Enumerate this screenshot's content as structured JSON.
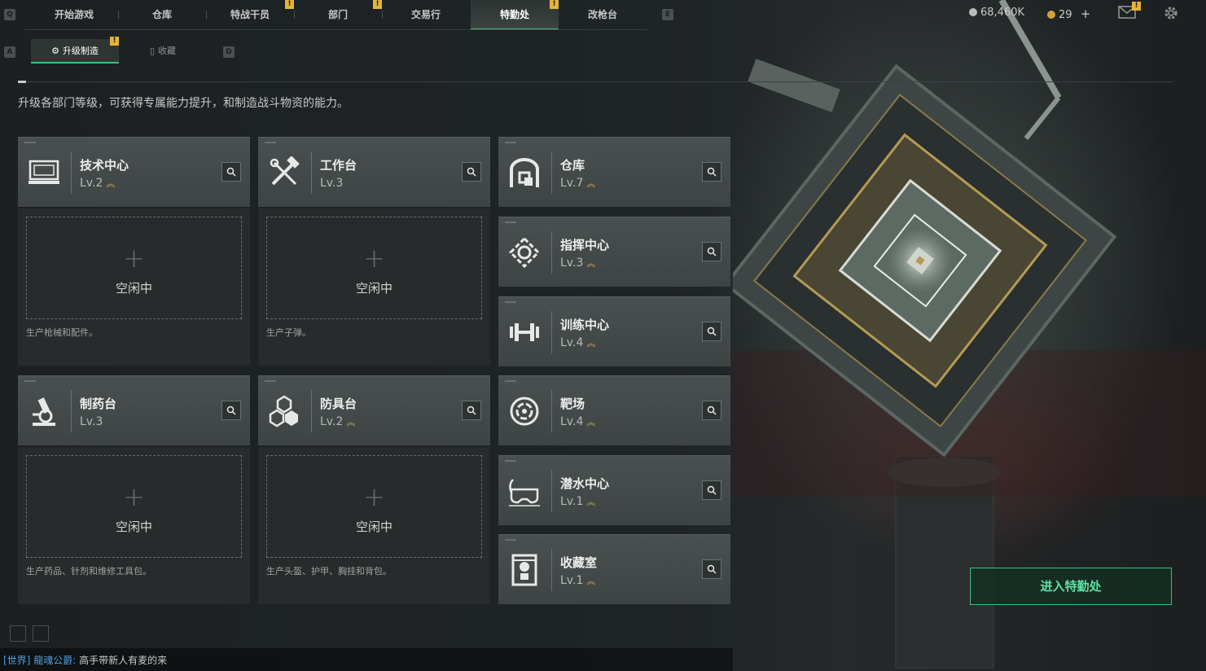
{
  "top_nav": {
    "key_left": "Q",
    "key_right": "E",
    "tabs": [
      {
        "label": "开始游戏",
        "badge": ""
      },
      {
        "label": "仓库",
        "badge": ""
      },
      {
        "label": "特战干员",
        "badge": "!"
      },
      {
        "label": "部门",
        "badge": "!"
      },
      {
        "label": "交易行",
        "badge": ""
      },
      {
        "label": "特勤处",
        "badge": "!"
      },
      {
        "label": "改枪台",
        "badge": ""
      }
    ],
    "active_tab": "特勤处",
    "coins": "68,460K",
    "coin_color": "#b8bcb9",
    "gems": "29",
    "gem_color": "#d4a23a",
    "gems_add": "+",
    "mail_badge": "!"
  },
  "sub_nav": {
    "key_left": "A",
    "key_right": "D",
    "tabs": [
      {
        "label": "升级制造",
        "badge": "!"
      },
      {
        "label": "收藏",
        "badge": ""
      }
    ]
  },
  "description": "升级各部门等级，可获得专属能力提升，和制造战斗物资的能力。",
  "cards": {
    "tech": {
      "name": "技术中心",
      "level": "Lv.2",
      "icon": "computer-icon",
      "idle": "空闲中",
      "desc": "生产枪械和配件。",
      "plus": "+"
    },
    "workbench": {
      "name": "工作台",
      "level": "Lv.3",
      "icon": "tools-icon",
      "idle": "空闲中",
      "desc": "生产子弹。",
      "plus": "+"
    },
    "pharmacy": {
      "name": "制药台",
      "level": "Lv.3",
      "icon": "microscope-icon",
      "idle": "空闲中",
      "desc": "生产药品、针剂和维修工具包。",
      "plus": "+"
    },
    "armor": {
      "name": "防具台",
      "level": "Lv.2",
      "icon": "armor-icon",
      "idle": "空闲中",
      "desc": "生产头盔、护甲、胸挂和背包。",
      "plus": "+"
    }
  },
  "facilities": [
    {
      "name": "仓库",
      "level": "Lv.7",
      "icon": "warehouse-icon"
    },
    {
      "name": "指挥中心",
      "level": "Lv.3",
      "icon": "command-icon"
    },
    {
      "name": "训练中心",
      "level": "Lv.4",
      "icon": "dumbbell-icon"
    },
    {
      "name": "靶场",
      "level": "Lv.4",
      "icon": "target-icon"
    },
    {
      "name": "潜水中心",
      "level": "Lv.1",
      "icon": "diving-mask-icon"
    },
    {
      "name": "收藏室",
      "level": "Lv.1",
      "icon": "collection-icon"
    }
  ],
  "upgrade_chevron": "︽",
  "enter_button": "进入特勤处",
  "chat": {
    "channel": "[世界]",
    "sender": "龍魂公爵:",
    "message": "高手带新人有麦的来",
    "channel_color": "#4f9fe0",
    "message_color": "#c8ccc9"
  },
  "accent_color": "#3fbf86"
}
